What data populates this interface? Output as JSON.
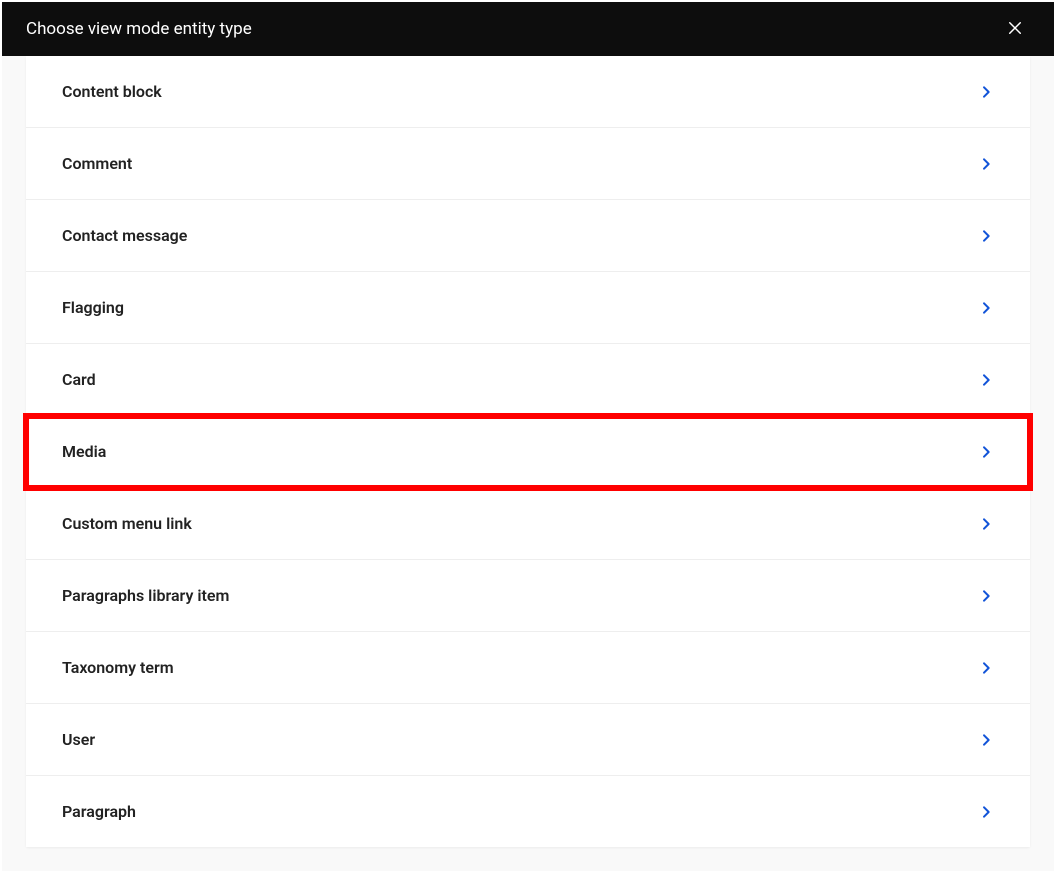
{
  "modal": {
    "title": "Choose view mode entity type"
  },
  "items": [
    {
      "label": "Content block",
      "highlighted": false
    },
    {
      "label": "Comment",
      "highlighted": false
    },
    {
      "label": "Contact message",
      "highlighted": false
    },
    {
      "label": "Flagging",
      "highlighted": false
    },
    {
      "label": "Card",
      "highlighted": false
    },
    {
      "label": "Media",
      "highlighted": true
    },
    {
      "label": "Custom menu link",
      "highlighted": false
    },
    {
      "label": "Paragraphs library item",
      "highlighted": false
    },
    {
      "label": "Taxonomy term",
      "highlighted": false
    },
    {
      "label": "User",
      "highlighted": false
    },
    {
      "label": "Paragraph",
      "highlighted": false
    }
  ]
}
